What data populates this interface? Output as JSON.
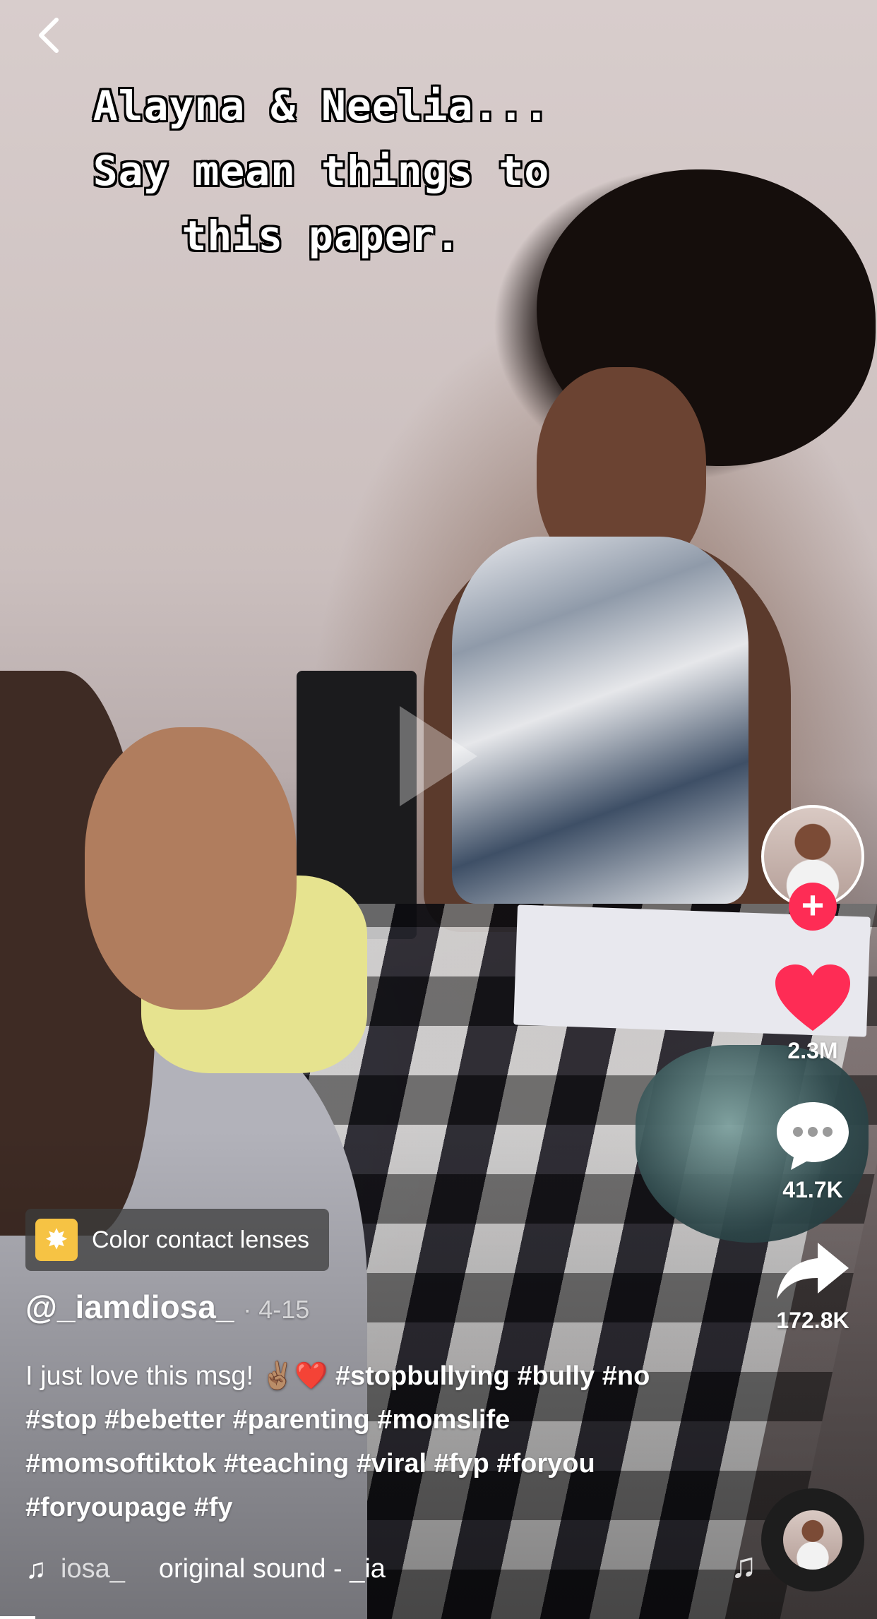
{
  "caption": {
    "line1": "Alayna & Neelia...",
    "line2": "Say mean things to",
    "line3": "this paper."
  },
  "rail": {
    "likes": "2.3M",
    "comments": "41.7K",
    "shares": "172.8K",
    "follow_symbol": "+"
  },
  "sticker": {
    "label": "Color contact lenses"
  },
  "post": {
    "username": "@_iamdiosa_",
    "date": "· 4-15",
    "text": "I just love this msg! ✌🏽❤️ ",
    "hashtags": "#stopbullying #bully #no #stop #bebetter #parenting #momslife #momsoftiktok #teaching #viral #fyp #foryou #foryoupage #fy"
  },
  "sound": {
    "source": "iosa_",
    "title": "original sound - _ia"
  },
  "colors": {
    "follow": "#fe2c55",
    "like": "#fe2c55",
    "sticker_icon": "#f6c344"
  },
  "icons": [
    "back-icon",
    "play-icon",
    "heart-icon",
    "comment-icon",
    "share-icon",
    "music-note-icon",
    "sparkle-icon"
  ]
}
